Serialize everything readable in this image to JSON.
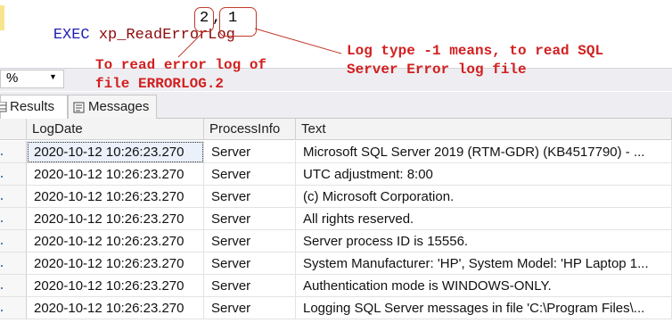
{
  "editor": {
    "keyword": "EXEC",
    "procedure": "xp_ReadErrorLog",
    "arg1": "2",
    "separator": ",",
    "arg2": "1"
  },
  "annotations": {
    "left_line1": "To read error log of",
    "left_line2": "file ERRORLOG.2",
    "right_line1": "Log type -1 means, to read SQL",
    "right_line2": "Server Error log file"
  },
  "zoom": {
    "value": "%",
    "icon": "chevron-down-icon"
  },
  "tabs": {
    "results": "Results",
    "messages": "Messages"
  },
  "table": {
    "headers": [
      "LogDate",
      "ProcessInfo",
      "Text"
    ],
    "rows": [
      [
        "2020-10-12 10:26:23.270",
        "Server",
        "Microsoft SQL Server 2019 (RTM-GDR) (KB4517790) - ..."
      ],
      [
        "2020-10-12 10:26:23.270",
        "Server",
        "UTC adjustment: 8:00"
      ],
      [
        "2020-10-12 10:26:23.270",
        "Server",
        "(c) Microsoft Corporation."
      ],
      [
        "2020-10-12 10:26:23.270",
        "Server",
        "All rights reserved."
      ],
      [
        "2020-10-12 10:26:23.270",
        "Server",
        "Server process ID is 15556."
      ],
      [
        "2020-10-12 10:26:23.270",
        "Server",
        "System Manufacturer: 'HP', System Model: 'HP Laptop 1..."
      ],
      [
        "2020-10-12 10:26:23.270",
        "Server",
        "Authentication mode is WINDOWS-ONLY."
      ],
      [
        "2020-10-12 10:26:23.270",
        "Server",
        "Logging SQL Server messages in file 'C:\\Program Files\\..."
      ]
    ]
  },
  "colors": {
    "annotation": "#d21f1f",
    "keyword": "#1e1eb4",
    "procedure": "#8b0a0a"
  }
}
